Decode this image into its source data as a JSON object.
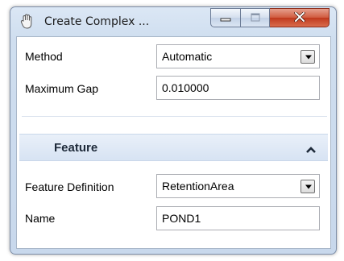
{
  "window": {
    "title": "Create Complex ...",
    "icon": "app-hand-icon"
  },
  "caption_buttons": {
    "minimize_icon": "minimize-icon",
    "maximize_icon": "maximize-icon",
    "close_icon": "close-icon"
  },
  "general": {
    "method_label": "Method",
    "method_value": "Automatic",
    "max_gap_label": "Maximum Gap",
    "max_gap_value": "0.010000"
  },
  "feature_group": {
    "title": "Feature",
    "collapse_icon": "chevron-up-icon",
    "feature_definition_label": "Feature Definition",
    "feature_definition_value": "RetentionArea",
    "name_label": "Name",
    "name_value": "POND1"
  },
  "colors": {
    "close_button": "#c8452a",
    "group_header": "#dfe9f6",
    "window_frame": "#cfdeef"
  }
}
